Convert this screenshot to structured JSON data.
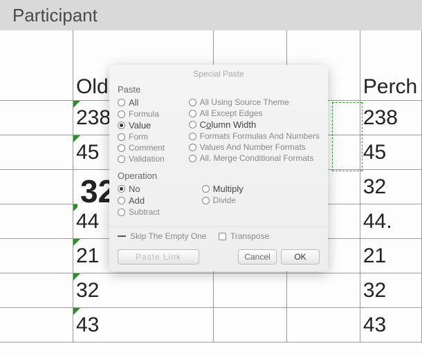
{
  "header": {
    "title": "Participant"
  },
  "columns": {
    "b_header": "Old",
    "e_header": "Perch"
  },
  "rows": [
    [
      "238",
      "238"
    ],
    [
      "45",
      "45"
    ],
    [
      "",
      "32"
    ],
    [
      "44",
      "44."
    ],
    [
      "21",
      "21"
    ],
    [
      "32",
      "32"
    ],
    [
      "43",
      "43"
    ]
  ],
  "floating_value": "32",
  "dialog": {
    "title": "Special Paste",
    "paste_section": "Paste",
    "operation_section": "Operation",
    "paste_options_left": [
      {
        "label": "All",
        "selected": false,
        "style": "bold"
      },
      {
        "label": "Formula",
        "selected": false
      },
      {
        "label": "Value",
        "selected": true,
        "style": "dark"
      },
      {
        "label": "Form",
        "selected": false
      },
      {
        "label": "Comment",
        "selected": false
      },
      {
        "label": "Validation",
        "selected": false
      }
    ],
    "paste_options_right": [
      {
        "label": "All Using Source Theme",
        "selected": false
      },
      {
        "label": "All Except Edges",
        "selected": false
      },
      {
        "label": "Column Width",
        "selected": false,
        "underline": "o",
        "style": "dark"
      },
      {
        "label": "Formats Formulas And Numbers",
        "selected": false
      },
      {
        "label": "Values And Number Formats",
        "selected": false
      },
      {
        "label": "All. Merge Conditional Formats",
        "selected": false
      }
    ],
    "op_options_left": [
      {
        "label": "No",
        "selected": true,
        "style": "bold"
      },
      {
        "label": "Add",
        "selected": false,
        "style": "bold"
      },
      {
        "label": "Subtract",
        "selected": false
      }
    ],
    "op_options_right": [
      {
        "label": "Multiply",
        "selected": false,
        "style": "dark"
      },
      {
        "label": "Divide",
        "selected": false
      }
    ],
    "skip_empty": "Skip The Empty One",
    "transpose": "Transpose",
    "paste_link": "Paste Link",
    "cancel": "Cancel",
    "ok": "OK"
  }
}
